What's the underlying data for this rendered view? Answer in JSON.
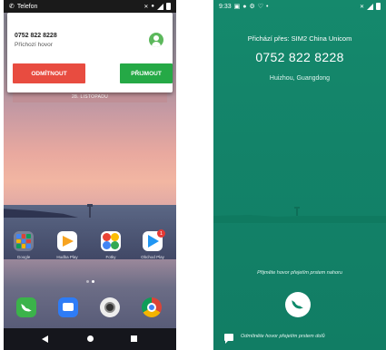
{
  "left": {
    "status_bar": {
      "app": "Telefon"
    },
    "notification": {
      "number": "0752 822 8228",
      "subtitle": "Příchozí hovor",
      "reject_label": "ODMÍTNOUT",
      "accept_label": "PŘIJMOUT"
    },
    "date_banner": "28. LISTOPADU",
    "apps": [
      {
        "label": "Google",
        "icon": "google-folder-icon"
      },
      {
        "label": "Hudba Play",
        "icon": "play-music-icon"
      },
      {
        "label": "Fotky",
        "icon": "photos-icon"
      },
      {
        "label": "Obchod Play",
        "icon": "play-store-icon",
        "badge": "1"
      }
    ],
    "dock": [
      "phone-icon",
      "messages-icon",
      "camera-icon",
      "chrome-icon"
    ],
    "nav": [
      "back-icon",
      "home-icon",
      "recents-icon"
    ]
  },
  "right": {
    "status_bar": {
      "time": "9:33"
    },
    "via": "Přichází přes: SIM2 China Unicom",
    "number": "0752 822 8228",
    "location": "Huizhou, Guangdong",
    "answer_hint": "Přijměte hovor přejetím prstem nahoru",
    "decline_hint": "Odmítněte hovor přejetím prstem dolů"
  },
  "colors": {
    "reject": "#e84c40",
    "accept": "#25a946",
    "incall_bg": "#138369"
  }
}
